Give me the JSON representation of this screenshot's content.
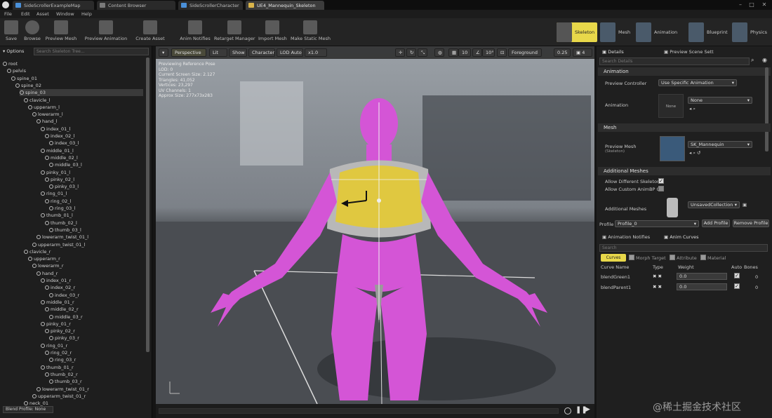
{
  "titlebar": {
    "tabs": [
      {
        "label": "SideScrollerExampleMap",
        "color": "#4a90d9"
      },
      {
        "label": "Content Browser",
        "color": "#7a7a7a"
      },
      {
        "label": "SideScrollerCharacter",
        "color": "#4a90d9"
      },
      {
        "label": "UE4_Mannequin_Skeleton",
        "color": "#d9b44a"
      }
    ]
  },
  "menubar": {
    "items": [
      "File",
      "Edit",
      "Asset",
      "Window",
      "Help"
    ]
  },
  "toolbar": {
    "tools": [
      {
        "label": "Save",
        "icon": "save-icon",
        "color": "#6a6a6a"
      },
      {
        "label": "Browse",
        "icon": "browse-icon",
        "color": "#6a6a6a"
      },
      {
        "label": "Preview Mesh",
        "icon": "preview-mesh-icon",
        "color": "#6a6a6a"
      },
      {
        "label": "Preview Animation",
        "icon": "preview-animation-icon",
        "color": "#6a6a6a"
      },
      {
        "label": "Create Asset",
        "icon": "create-asset-icon",
        "color": "#6a6a6a"
      },
      {
        "label": "Anim Notifies",
        "icon": "anim-notifies-icon",
        "color": "#6a6a6a"
      },
      {
        "label": "Retarget Manager",
        "icon": "retarget-icon",
        "color": "#6a6a6a"
      },
      {
        "label": "Import Mesh",
        "icon": "import-mesh-icon",
        "color": "#6a6a6a"
      },
      {
        "label": "Make Static Mesh",
        "icon": "static-mesh-icon",
        "color": "#6a6a6a"
      }
    ],
    "modes": [
      {
        "label": "Skeleton",
        "active": true
      },
      {
        "label": "Mesh",
        "active": false
      },
      {
        "label": "Animation",
        "active": false
      },
      {
        "label": "Blueprint",
        "active": false
      },
      {
        "label": "Physics",
        "active": false
      }
    ]
  },
  "skeleton_tree": {
    "options_label": "Options",
    "search_placeholder": "Search Skeleton Tree...",
    "rows": [
      {
        "name": "root",
        "depth": 0
      },
      {
        "name": "pelvis",
        "depth": 1
      },
      {
        "name": "spine_01",
        "depth": 2
      },
      {
        "name": "spine_02",
        "depth": 3
      },
      {
        "name": "spine_03",
        "depth": 4,
        "selected": true
      },
      {
        "name": "clavicle_l",
        "depth": 5
      },
      {
        "name": "upperarm_l",
        "depth": 6
      },
      {
        "name": "lowerarm_l",
        "depth": 7
      },
      {
        "name": "hand_l",
        "depth": 8
      },
      {
        "name": "index_01_l",
        "depth": 9
      },
      {
        "name": "index_02_l",
        "depth": 10
      },
      {
        "name": "index_03_l",
        "depth": 11
      },
      {
        "name": "middle_01_l",
        "depth": 9
      },
      {
        "name": "middle_02_l",
        "depth": 10
      },
      {
        "name": "middle_03_l",
        "depth": 11
      },
      {
        "name": "pinky_01_l",
        "depth": 9
      },
      {
        "name": "pinky_02_l",
        "depth": 10
      },
      {
        "name": "pinky_03_l",
        "depth": 11
      },
      {
        "name": "ring_01_l",
        "depth": 9
      },
      {
        "name": "ring_02_l",
        "depth": 10
      },
      {
        "name": "ring_03_l",
        "depth": 11
      },
      {
        "name": "thumb_01_l",
        "depth": 9
      },
      {
        "name": "thumb_02_l",
        "depth": 10
      },
      {
        "name": "thumb_03_l",
        "depth": 11
      },
      {
        "name": "lowerarm_twist_01_l",
        "depth": 8
      },
      {
        "name": "upperarm_twist_01_l",
        "depth": 7
      },
      {
        "name": "clavicle_r",
        "depth": 5
      },
      {
        "name": "upperarm_r",
        "depth": 6
      },
      {
        "name": "lowerarm_r",
        "depth": 7
      },
      {
        "name": "hand_r",
        "depth": 8
      },
      {
        "name": "index_01_r",
        "depth": 9
      },
      {
        "name": "index_02_r",
        "depth": 10
      },
      {
        "name": "index_03_r",
        "depth": 11
      },
      {
        "name": "middle_01_r",
        "depth": 9
      },
      {
        "name": "middle_02_r",
        "depth": 10
      },
      {
        "name": "middle_03_r",
        "depth": 11
      },
      {
        "name": "pinky_01_r",
        "depth": 9
      },
      {
        "name": "pinky_02_r",
        "depth": 10
      },
      {
        "name": "pinky_03_r",
        "depth": 11
      },
      {
        "name": "ring_01_r",
        "depth": 9
      },
      {
        "name": "ring_02_r",
        "depth": 10
      },
      {
        "name": "ring_03_r",
        "depth": 11
      },
      {
        "name": "thumb_01_r",
        "depth": 9
      },
      {
        "name": "thumb_02_r",
        "depth": 10
      },
      {
        "name": "thumb_03_r",
        "depth": 11
      },
      {
        "name": "lowerarm_twist_01_r",
        "depth": 8
      },
      {
        "name": "upperarm_twist_01_r",
        "depth": 7
      },
      {
        "name": "neck_01",
        "depth": 5
      }
    ],
    "blend_profile_label": "Blend Profile: None"
  },
  "viewport": {
    "toolbar": {
      "perspective": "Perspective",
      "lit": "Lit",
      "show": "Show",
      "character": "Character",
      "lod": "LOD Auto",
      "speed": "x1.0",
      "grid": "10",
      "angle": "10°",
      "foreground": "Foreground",
      "scale": "0.25",
      "camera": "4"
    },
    "stats": [
      "Previewing Reference Pose",
      "LOD: 0",
      "Current Screen Size: 2.127",
      "Triangles: 41,052",
      "Vertices: 23,297",
      "UV Channels: 1",
      "Approx Size: 277x73x283"
    ]
  },
  "details": {
    "tab_details": "Details",
    "tab_preview": "Preview Scene Sett",
    "search_placeholder": "Search Details",
    "animation_section": "Animation",
    "preview_controller_label": "Preview Controller",
    "preview_controller_value": "Use Specific Animation",
    "animation_label": "Animation",
    "animation_thumb": "None",
    "animation_value": "None",
    "mesh_section": "Mesh",
    "preview_mesh_label": "Preview Mesh",
    "preview_mesh_sub": "(Skeleton)",
    "preview_mesh_value": "SK_Mannequin",
    "additional_section": "Additional Meshes",
    "allow_skeletons": "Allow Different Skeletons",
    "allow_animbp": "Allow Custom AnimBP Ov",
    "additional_meshes_label": "Additional Meshes",
    "additional_meshes_value": "UnsavedCollection",
    "profile_label": "Profile",
    "profile_value": "Profile_0",
    "add_profile": "Add Profile",
    "remove_profile": "Remove Profile"
  },
  "curves": {
    "tab_notifies": "Animation Notifies",
    "tab_curves": "Anim Curves",
    "search_placeholder": "Search",
    "filters": [
      "Curves",
      "Morph Target",
      "Attribute",
      "Material"
    ],
    "headers": [
      "Curve Name",
      "Type",
      "Weight",
      "Auto",
      "Bones"
    ],
    "rows": [
      {
        "name": "blendGreen1",
        "weight": "0.0",
        "bones": "0"
      },
      {
        "name": "blendParent1",
        "weight": "0.0",
        "bones": "0"
      }
    ]
  },
  "watermark": "@稀土掘金技术社区",
  "colors": {
    "accent_yellow": "#e8d84a",
    "mesh_magenta": "#d455d6",
    "chest_yellow": "#e0c840"
  }
}
